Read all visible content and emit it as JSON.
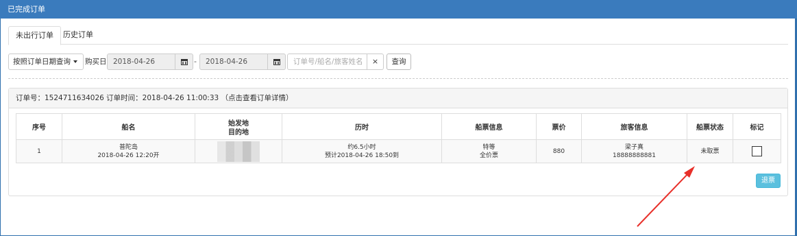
{
  "window": {
    "title": "已完成订单"
  },
  "tabs": [
    {
      "label": "未出行订单",
      "active": true
    },
    {
      "label": "历史订单",
      "active": false
    }
  ],
  "filter": {
    "select_value": "按照订单日期查询",
    "date_label": "购买日",
    "start_date": "2018-04-26",
    "separator": "-",
    "end_date": "2018-04-26",
    "search_placeholder": "订单号/船名/旅客姓名",
    "clear_symbol": "×",
    "query_label": "查询"
  },
  "order": {
    "header": "订单号：1524711634026 订单时间：2018-04-26 11:00:33 （点击查看订单详情）",
    "columns": [
      "序号",
      "船名",
      "始发地",
      "目的地",
      "历时",
      "船票信息",
      "票价",
      "旅客信息",
      "船票状态",
      "标记"
    ],
    "row": {
      "index": "1",
      "ship_name": "普陀岛",
      "departure": "2018-04-26 12:20开",
      "duration": "约6.5小时",
      "arrival": "预计2018-04-26 18:50到",
      "ticket_class": "特等",
      "ticket_type": "全价票",
      "price": "880",
      "passenger_name": "梁子真",
      "passenger_phone": "18888888881",
      "status": "未取票",
      "marked": false
    },
    "refund_label": "退票"
  },
  "colors": {
    "titlebar": "#3a7bbd",
    "refund_button": "#5bc0de",
    "annotation_arrow": "#e8302a"
  },
  "icons": [
    "calendar-icon",
    "close-icon",
    "caret-down-icon",
    "annotation-arrow"
  ]
}
